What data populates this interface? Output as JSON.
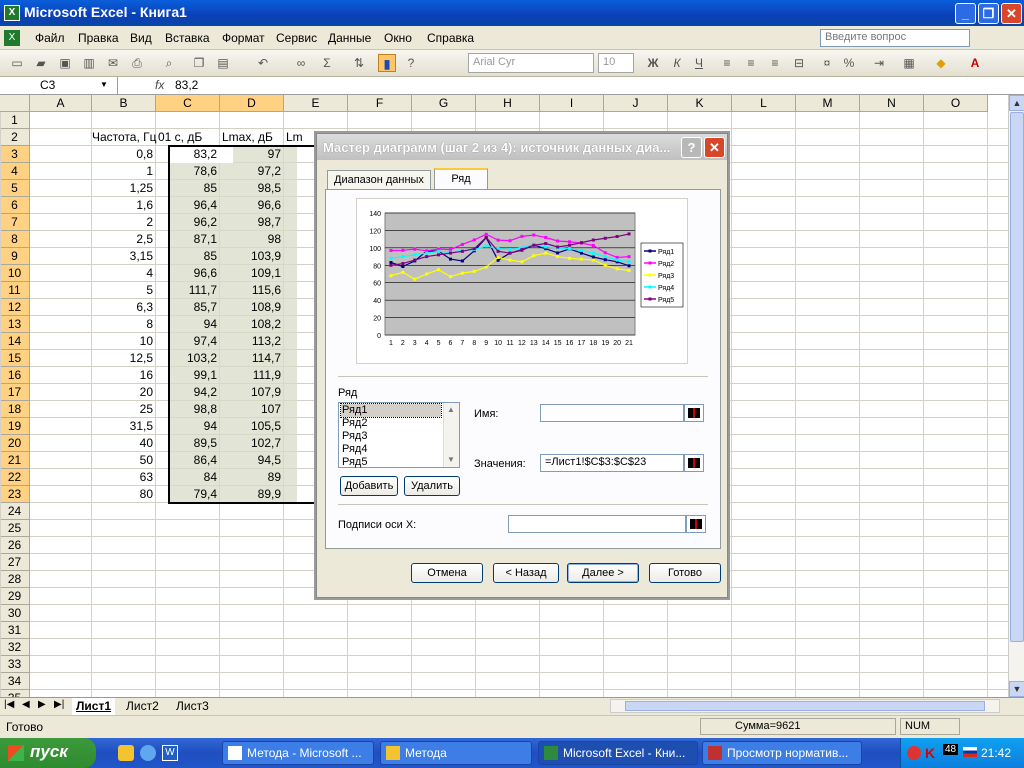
{
  "window": {
    "title": "Microsoft Excel - Книга1",
    "icon": "excel-icon"
  },
  "menu": [
    "Файл",
    "Правка",
    "Вид",
    "Вставка",
    "Формат",
    "Сервис",
    "Данные",
    "Окно",
    "Справка"
  ],
  "question_placeholder": "Введите вопрос",
  "toolbar": {
    "font": "Arial Cyr",
    "size": "10"
  },
  "formula_bar": {
    "name_box": "C3",
    "fx": "fx",
    "value": "83,2"
  },
  "columns": [
    "A",
    "B",
    "C",
    "D",
    "E",
    "F",
    "G",
    "H",
    "I",
    "J",
    "K",
    "L",
    "M",
    "N",
    "O"
  ],
  "rows": [
    "1",
    "2",
    "3",
    "4",
    "5",
    "6",
    "7",
    "8",
    "9",
    "10",
    "11",
    "12",
    "13",
    "14",
    "15",
    "16",
    "17",
    "18",
    "19",
    "20",
    "21",
    "22",
    "23",
    "24",
    "25",
    "26",
    "27",
    "28",
    "29",
    "30",
    "31",
    "32",
    "33",
    "34",
    "35"
  ],
  "headers": {
    "b": "Частота, Гц",
    "c": "01 с, дБ",
    "d": "Lmax, дБ",
    "e": "Lm"
  },
  "table": [
    [
      "0,8",
      "83,2",
      "97"
    ],
    [
      "1",
      "78,6",
      "97,2"
    ],
    [
      "1,25",
      "85",
      "98,5"
    ],
    [
      "1,6",
      "96,4",
      "96,6"
    ],
    [
      "2",
      "96,2",
      "98,7"
    ],
    [
      "2,5",
      "87,1",
      "98"
    ],
    [
      "3,15",
      "85",
      "103,9"
    ],
    [
      "4",
      "96,6",
      "109,1"
    ],
    [
      "5",
      "111,7",
      "115,6"
    ],
    [
      "6,3",
      "85,7",
      "108,9"
    ],
    [
      "8",
      "94",
      "108,2"
    ],
    [
      "10",
      "97,4",
      "113,2"
    ],
    [
      "12,5",
      "103,2",
      "114,7"
    ],
    [
      "16",
      "99,1",
      "111,9"
    ],
    [
      "20",
      "94,2",
      "107,9"
    ],
    [
      "25",
      "98,8",
      "107"
    ],
    [
      "31,5",
      "94",
      "105,5"
    ],
    [
      "40",
      "89,5",
      "102,7"
    ],
    [
      "50",
      "86,4",
      "94,5"
    ],
    [
      "63",
      "84",
      "89"
    ],
    [
      "80",
      "79,4",
      "89,9"
    ]
  ],
  "sheets": [
    "Лист1",
    "Лист2",
    "Лист3"
  ],
  "status": {
    "ready": "Готово",
    "sum": "Сумма=9621",
    "num": "NUM"
  },
  "dialog": {
    "title": "Мастер диаграмм (шаг 2 из 4): источник данных диа...",
    "tabs": [
      "Диапазон данных",
      "Ряд"
    ],
    "series_label": "Ряд",
    "series_items": [
      "Ряд1",
      "Ряд2",
      "Ряд3",
      "Ряд4",
      "Ряд5"
    ],
    "name_label": "Имя:",
    "values_label": "Значения:",
    "values_value": "=Лист1!$C$3:$C$23",
    "add": "Добавить",
    "remove": "Удалить",
    "xlabels_label": "Подписи оси X:",
    "cancel": "Отмена",
    "back": "< Назад",
    "next": "Далее >",
    "finish": "Готово"
  },
  "chart_data": {
    "type": "line",
    "x": [
      1,
      2,
      3,
      4,
      5,
      6,
      7,
      8,
      9,
      10,
      11,
      12,
      13,
      14,
      15,
      16,
      17,
      18,
      19,
      20,
      21
    ],
    "ylim": [
      0,
      140
    ],
    "yticks": [
      0,
      20,
      40,
      60,
      80,
      100,
      120,
      140
    ],
    "grid": true,
    "legend": "right",
    "series": [
      {
        "name": "Ряд1",
        "color": "#000080",
        "values": [
          83.2,
          78.6,
          85,
          96.4,
          96.2,
          87.1,
          85,
          96.6,
          111.7,
          85.7,
          94,
          97.4,
          103.2,
          99.1,
          94.2,
          98.8,
          94,
          89.5,
          86.4,
          84,
          79.4
        ]
      },
      {
        "name": "Ряд2",
        "color": "#FF00FF",
        "values": [
          97,
          97.2,
          98.5,
          96.6,
          98.7,
          98,
          103.9,
          109.1,
          115.6,
          108.9,
          108.2,
          113.2,
          114.7,
          111.9,
          107.9,
          107,
          105.5,
          102.7,
          94.5,
          89,
          89.9
        ]
      },
      {
        "name": "Ряд3",
        "color": "#FFFF00",
        "values": [
          68,
          72,
          64,
          70,
          75,
          67,
          71,
          73,
          78,
          89,
          86,
          84,
          91,
          94,
          90,
          88,
          87,
          86,
          80,
          76,
          74
        ]
      },
      {
        "name": "Ряд4",
        "color": "#00FFFF",
        "values": [
          88,
          90,
          92,
          94,
          96,
          95,
          97,
          98,
          102,
          99,
          98,
          100,
          104,
          101,
          100,
          99,
          97,
          94,
          90,
          86,
          84
        ]
      },
      {
        "name": "Ряд5",
        "color": "#800080",
        "values": [
          80,
          82,
          86,
          90,
          92,
          94,
          96,
          99,
          112,
          96,
          94,
          98,
          103,
          105,
          101,
          103,
          106,
          109,
          111,
          113,
          116
        ]
      }
    ]
  },
  "taskbar": {
    "start": "пуск",
    "tasks": [
      "Метода - Microsoft ...",
      "Метода",
      "Microsoft Excel - Кни...",
      "Просмотр норматив..."
    ],
    "clock": "21:42",
    "tray_badge": "48"
  }
}
